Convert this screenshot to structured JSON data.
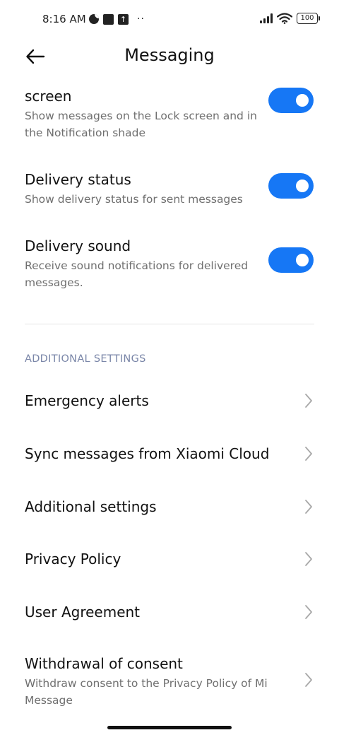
{
  "status_bar": {
    "time": "8:16 AM",
    "dots": "··",
    "upload_glyph": "↑",
    "battery": "100",
    "icons": [
      "moon-clock-icon",
      "square-notification-icon",
      "upload-notification-icon",
      "signal-icon",
      "wifi-icon",
      "battery-icon"
    ]
  },
  "header": {
    "back_icon": "back-arrow-icon",
    "title": "Messaging"
  },
  "toggles": [
    {
      "title": "screen",
      "subtitle": "Show messages on the Lock screen and in the Notification shade",
      "on": true
    },
    {
      "title": "Delivery status",
      "subtitle": "Show delivery status for sent messages",
      "on": true
    },
    {
      "title": "Delivery sound",
      "subtitle": "Receive sound notifications for delivered messages.",
      "on": true
    }
  ],
  "section": {
    "header": "ADDITIONAL SETTINGS"
  },
  "nav_items": [
    {
      "title": "Emergency alerts"
    },
    {
      "title": "Sync messages from Xiaomi Cloud"
    },
    {
      "title": "Additional settings"
    },
    {
      "title": "Privacy Policy"
    },
    {
      "title": "User Agreement"
    },
    {
      "title": "Withdrawal of consent",
      "subtitle": "Withdraw consent to the Privacy Policy of Mi Message"
    }
  ],
  "colors": {
    "accent": "#1677f5",
    "section_header": "#7a86a8",
    "subtitle": "#6f6f6f"
  }
}
